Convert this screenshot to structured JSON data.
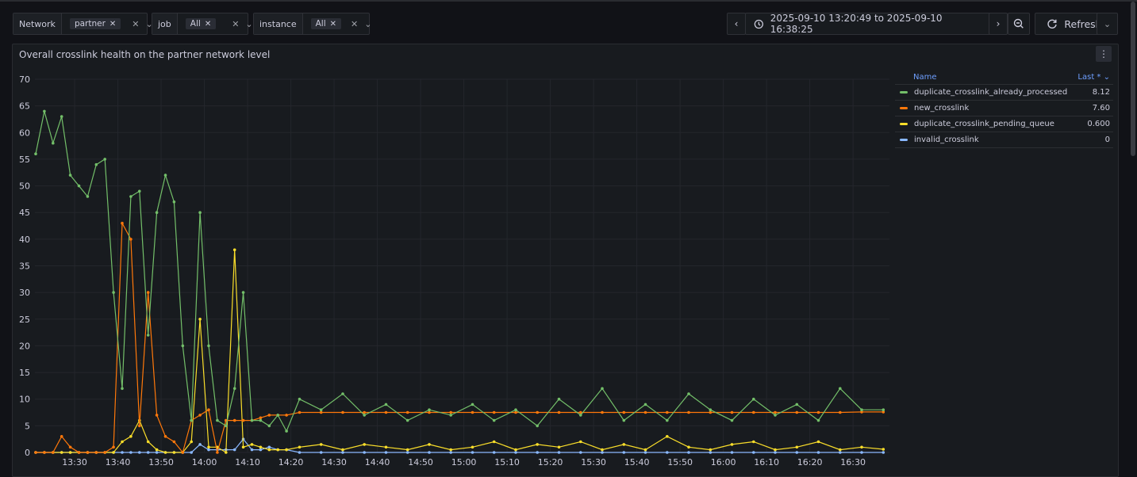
{
  "variables": [
    {
      "label": "Network",
      "value": "partner"
    },
    {
      "label": "job",
      "value": "All"
    },
    {
      "label": "instance",
      "value": "All"
    }
  ],
  "time_range": {
    "text": "2025-09-10 13:20:49 to 2025-09-10 16:38:25"
  },
  "refresh_label": "Refresh",
  "panel": {
    "title": "Overall crosslink health on the partner network level"
  },
  "legend": {
    "col_name": "Name",
    "col_last": "Last *",
    "items": [
      {
        "name": "duplicate_crosslink_already_processed",
        "last": "8.12",
        "color": "#73bf69"
      },
      {
        "name": "new_crosslink",
        "last": "7.60",
        "color": "#ff780a"
      },
      {
        "name": "duplicate_crosslink_pending_queue",
        "last": "0.600",
        "color": "#fade2a"
      },
      {
        "name": "invalid_crosslink",
        "last": "0",
        "color": "#8ab8ff"
      }
    ]
  },
  "chart_data": {
    "type": "line",
    "y_ticks": [
      "0",
      "5",
      "10",
      "15",
      "20",
      "25",
      "30",
      "35",
      "40",
      "45",
      "50",
      "55",
      "60",
      "65",
      "70"
    ],
    "x_ticks": [
      "13:30",
      "13:40",
      "13:50",
      "14:00",
      "14:10",
      "14:20",
      "14:30",
      "14:40",
      "14:50",
      "15:00",
      "15:10",
      "15:20",
      "15:30",
      "15:40",
      "15:50",
      "16:00",
      "16:10",
      "16:20",
      "16:30"
    ],
    "ylim": [
      0,
      70
    ],
    "xlim": [
      "13:20:49",
      "16:38:25"
    ],
    "x": [
      "13:21",
      "13:23",
      "13:25",
      "13:27",
      "13:29",
      "13:31",
      "13:33",
      "13:35",
      "13:37",
      "13:39",
      "13:41",
      "13:43",
      "13:45",
      "13:47",
      "13:49",
      "13:51",
      "13:53",
      "13:55",
      "13:57",
      "13:59",
      "14:01",
      "14:03",
      "14:05",
      "14:07",
      "14:09",
      "14:11",
      "14:13",
      "14:15",
      "14:17",
      "14:19",
      "14:22",
      "14:27",
      "14:32",
      "14:37",
      "14:42",
      "14:47",
      "14:52",
      "14:57",
      "15:02",
      "15:07",
      "15:12",
      "15:17",
      "15:22",
      "15:27",
      "15:32",
      "15:37",
      "15:42",
      "15:47",
      "15:52",
      "15:57",
      "16:02",
      "16:07",
      "16:12",
      "16:17",
      "16:22",
      "16:27",
      "16:32",
      "16:37"
    ],
    "series": [
      {
        "name": "duplicate_crosslink_already_processed",
        "color": "#73bf69",
        "values": [
          56,
          64,
          58,
          63,
          52,
          50,
          48,
          54,
          55,
          30,
          12,
          48,
          49,
          22,
          45,
          52,
          47,
          20,
          6,
          45,
          20,
          6,
          5,
          12,
          30,
          6,
          6,
          5,
          7,
          4,
          10,
          8,
          11,
          7,
          9,
          6,
          8,
          7,
          9,
          6,
          8,
          5,
          10,
          7,
          12,
          6,
          9,
          6,
          11,
          8,
          6,
          10,
          7,
          9,
          6,
          12,
          8,
          8
        ]
      },
      {
        "name": "new_crosslink",
        "color": "#ff780a",
        "values": [
          0,
          0,
          0,
          3,
          1,
          0,
          0,
          0,
          0,
          1,
          43,
          40,
          5,
          30,
          7,
          3,
          2,
          0,
          6,
          7,
          8,
          0,
          6,
          6,
          6,
          6,
          6.5,
          7,
          7,
          7,
          7.5,
          7.5,
          7.5,
          7.5,
          7.5,
          7.5,
          7.5,
          7.5,
          7.5,
          7.5,
          7.5,
          7.5,
          7.5,
          7.5,
          7.5,
          7.5,
          7.5,
          7.5,
          7.5,
          7.5,
          7.5,
          7.5,
          7.5,
          7.5,
          7.5,
          7.5,
          7.6,
          7.6
        ]
      },
      {
        "name": "duplicate_crosslink_pending_queue",
        "color": "#fade2a",
        "values": [
          0,
          0,
          0,
          0,
          0,
          0,
          0,
          0,
          0,
          0,
          2,
          3,
          6,
          2,
          0.5,
          0,
          0,
          0,
          2,
          25,
          1,
          1,
          0,
          38,
          1,
          1.5,
          1,
          0.5,
          0.5,
          0.5,
          1,
          1.5,
          0.5,
          1.5,
          1,
          0.5,
          1.5,
          0.5,
          1,
          2,
          0.5,
          1.5,
          1,
          2,
          0.5,
          1.5,
          0.5,
          3,
          1,
          0.5,
          1.5,
          2,
          0.5,
          1,
          2,
          0.5,
          1,
          0.6
        ]
      },
      {
        "name": "invalid_crosslink",
        "color": "#8ab8ff",
        "values": [
          0,
          0,
          0,
          0,
          0,
          0,
          0,
          0,
          0,
          0,
          0,
          0,
          0,
          0,
          0,
          0,
          0,
          0,
          0,
          1.5,
          0.5,
          0.5,
          0.5,
          0.5,
          2.5,
          0.5,
          0.5,
          1,
          0.5,
          0.5,
          0,
          0,
          0,
          0,
          0,
          0,
          0,
          0,
          0,
          0,
          0,
          0,
          0,
          0,
          0,
          0,
          0,
          0,
          0,
          0,
          0,
          0,
          0,
          0,
          0,
          0,
          0,
          0
        ]
      }
    ]
  }
}
